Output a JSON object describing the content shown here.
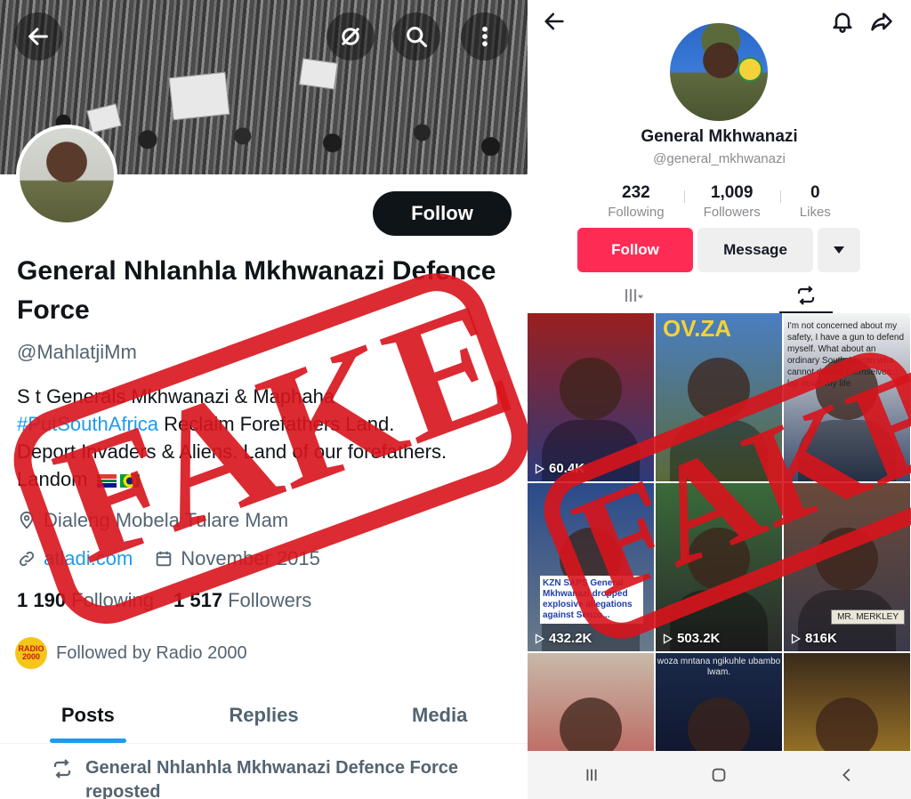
{
  "left_profile": {
    "name": "General Nhlanhla Mkhwanazi Defence Force",
    "handle": "@MahlatjiMm",
    "follow_label": "Follow",
    "bio_line1": "S     t Generals Mkhwanazi & Maphaha",
    "bio_link": "#PutSouthAfrica",
    "bio_line2_rest": " Reclaim Forefathers Land.",
    "bio_line3": "Deport Invaders & Aliens. Land of our forefathers.",
    "bio_line4": "Landom     ",
    "location": "Dialeng Mobela Tulare Mam",
    "website": "atladi.com",
    "joined": "November 2015",
    "following_count": "1 190",
    "following_label": "Following",
    "followers_count": "1 517",
    "followers_label": "Followers",
    "followed_by": "Followed by Radio 2000",
    "radio_logo_text": "RADIO 2000",
    "tabs": [
      {
        "label": "Posts",
        "active": true
      },
      {
        "label": "Replies",
        "active": false
      },
      {
        "label": "Media",
        "active": false
      }
    ],
    "repost_text": "General Nhlanhla Mkhwanazi Defence Force reposted"
  },
  "right_profile": {
    "name": "General Mkhwanazi",
    "handle": "@general_mkhwanazi",
    "stats": [
      {
        "value": "232",
        "label": "Following"
      },
      {
        "value": "1,009",
        "label": "Followers"
      },
      {
        "value": "0",
        "label": "Likes"
      }
    ],
    "follow_label": "Follow",
    "message_label": "Message",
    "videos": [
      {
        "views": "60.4K",
        "colors": [
          "#9a1f1f",
          "#2d3a7a"
        ]
      },
      {
        "views": "",
        "top_text": "OV.ZA",
        "colors": [
          "#4a7fc2",
          "#5a6a3a"
        ]
      },
      {
        "views": "",
        "text": "I'm not concerned about my safety, I have a gun to defend myself. What about an ordinary South African who cannot defend themselves... lay down my life",
        "colors": [
          "#f4f4f4",
          "#3a4a6a"
        ]
      },
      {
        "views": "432.2K",
        "overlay": "KZN SAPS General Mkhwanazi dropped explosive allegations against Senzo...",
        "colors": [
          "#2a4a8a",
          "#6a7a8a"
        ]
      },
      {
        "views": "503.2K",
        "colors": [
          "#3a6a3a",
          "#2a2a2a"
        ]
      },
      {
        "views": "816K",
        "plate": "MR. MERKLEY",
        "colors": [
          "#6a4a3a",
          "#3a3a4a"
        ]
      },
      {
        "views": "",
        "colors": [
          "#c8b9a8",
          "#b83a3a"
        ]
      },
      {
        "views": "",
        "caption": "woza mntana ngikuhle ubambo lwam.",
        "colors": [
          "#1a2a4a",
          "#0a0a1a"
        ]
      },
      {
        "views": "",
        "colors": [
          "#3a2a1a",
          "#d4a030"
        ]
      }
    ]
  },
  "stamps": {
    "left_word": "FAKE",
    "right_word": "FAKE",
    "color": "#d8141c"
  },
  "icons": {
    "back": "back-arrow-icon",
    "no_bell": "hide-icon",
    "search": "search-icon",
    "more": "more-vertical-icon",
    "bell": "bell-icon",
    "share": "share-icon"
  }
}
